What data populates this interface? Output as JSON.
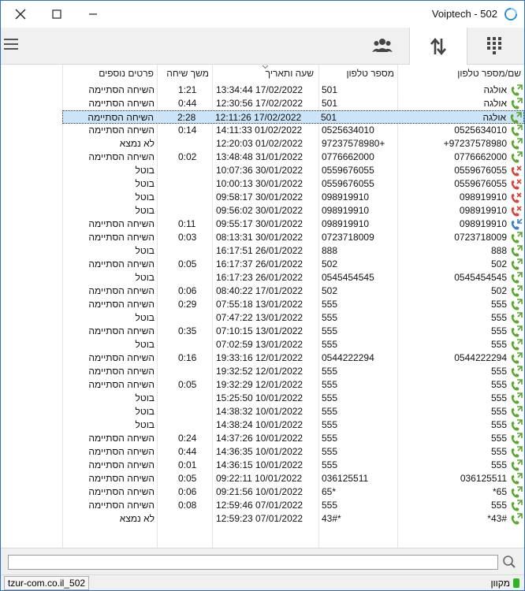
{
  "window": {
    "title": "Voiptech - 502",
    "brand_color": "#2b73c7"
  },
  "tabs": [
    {
      "name": "contacts",
      "icon": "contacts-icon"
    },
    {
      "name": "calls",
      "icon": "arrows-updown-icon",
      "active": true
    },
    {
      "name": "dialpad",
      "icon": "dialpad-icon"
    }
  ],
  "table": {
    "headers": {
      "name": "שם/מספר טלפון",
      "phone": "מספר טלפון",
      "datetime": "שעה ותאריך",
      "duration": "משך שיחה",
      "details": "פרטים נוספים"
    },
    "rows": [
      {
        "type": "out",
        "name": "אולגה",
        "phone": "501",
        "datetime": "13:34:44 17/02/2022",
        "duration": "1:21",
        "details": "השיחה הסתיימה"
      },
      {
        "type": "out",
        "name": "אולגה",
        "phone": "501",
        "datetime": "12:30:56 17/02/2022",
        "duration": "0:44",
        "details": "השיחה הסתיימה"
      },
      {
        "type": "out",
        "name": "אולגה",
        "phone": "501",
        "datetime": "12:11:26 17/02/2022",
        "duration": "2:28",
        "details": "השיחה הסתיימה",
        "selected": true
      },
      {
        "type": "out",
        "name": "0525634010",
        "phone": "0525634010",
        "datetime": "14:11:33 01/02/2022",
        "duration": "0:14",
        "details": "השיחה הסתיימה"
      },
      {
        "type": "out",
        "name": "97237578980+",
        "phone": "97237578980+",
        "datetime": "12:20:03 01/02/2022",
        "duration": "",
        "details": "לא נמצא"
      },
      {
        "type": "out",
        "name": "0776662000",
        "phone": "0776662000",
        "datetime": "13:48:48 31/01/2022",
        "duration": "0:02",
        "details": "השיחה הסתיימה"
      },
      {
        "type": "missed",
        "name": "0559676055",
        "phone": "0559676055",
        "datetime": "10:07:36 30/01/2022",
        "duration": "",
        "details": "בוטל"
      },
      {
        "type": "missed",
        "name": "0559676055",
        "phone": "0559676055",
        "datetime": "10:00:13 30/01/2022",
        "duration": "",
        "details": "בוטל"
      },
      {
        "type": "missed",
        "name": "098919910",
        "phone": "098919910",
        "datetime": "09:58:17 30/01/2022",
        "duration": "",
        "details": "בוטל"
      },
      {
        "type": "missed",
        "name": "098919910",
        "phone": "098919910",
        "datetime": "09:56:02 30/01/2022",
        "duration": "",
        "details": "בוטל"
      },
      {
        "type": "in",
        "name": "098919910",
        "phone": "098919910",
        "datetime": "09:55:17 30/01/2022",
        "duration": "0:11",
        "details": "השיחה הסתיימה"
      },
      {
        "type": "out",
        "name": "0723718009",
        "phone": "0723718009",
        "datetime": "08:13:31 30/01/2022",
        "duration": "0:03",
        "details": "השיחה הסתיימה"
      },
      {
        "type": "out",
        "name": "888",
        "phone": "888",
        "datetime": "16:17:51 26/01/2022",
        "duration": "",
        "details": "בוטל"
      },
      {
        "type": "out",
        "name": "502",
        "phone": "502",
        "datetime": "16:17:37 26/01/2022",
        "duration": "0:05",
        "details": "השיחה הסתיימה"
      },
      {
        "type": "out",
        "name": "0545454545",
        "phone": "0545454545",
        "datetime": "16:17:23 26/01/2022",
        "duration": "",
        "details": "בוטל"
      },
      {
        "type": "out",
        "name": "502",
        "phone": "502",
        "datetime": "08:40:22 17/01/2022",
        "duration": "0:06",
        "details": "השיחה הסתיימה"
      },
      {
        "type": "out",
        "name": "555",
        "phone": "555",
        "datetime": "07:55:18 13/01/2022",
        "duration": "0:29",
        "details": "השיחה הסתיימה"
      },
      {
        "type": "out",
        "name": "555",
        "phone": "555",
        "datetime": "07:47:22 13/01/2022",
        "duration": "",
        "details": "בוטל"
      },
      {
        "type": "out",
        "name": "555",
        "phone": "555",
        "datetime": "07:10:15 13/01/2022",
        "duration": "0:35",
        "details": "השיחה הסתיימה"
      },
      {
        "type": "out",
        "name": "555",
        "phone": "555",
        "datetime": "07:02:59 13/01/2022",
        "duration": "",
        "details": "בוטל"
      },
      {
        "type": "out",
        "name": "0544222294",
        "phone": "0544222294",
        "datetime": "19:33:16 12/01/2022",
        "duration": "0:16",
        "details": "השיחה הסתיימה"
      },
      {
        "type": "out",
        "name": "555",
        "phone": "555",
        "datetime": "19:32:52 12/01/2022",
        "duration": "",
        "details": "השיחה הסתיימה"
      },
      {
        "type": "out",
        "name": "555",
        "phone": "555",
        "datetime": "19:32:29 12/01/2022",
        "duration": "0:05",
        "details": "השיחה הסתיימה"
      },
      {
        "type": "out",
        "name": "555",
        "phone": "555",
        "datetime": "15:25:50 10/01/2022",
        "duration": "",
        "details": "בוטל"
      },
      {
        "type": "out",
        "name": "555",
        "phone": "555",
        "datetime": "14:38:32 10/01/2022",
        "duration": "",
        "details": "בוטל"
      },
      {
        "type": "out",
        "name": "555",
        "phone": "555",
        "datetime": "14:38:24 10/01/2022",
        "duration": "",
        "details": "בוטל"
      },
      {
        "type": "out",
        "name": "555",
        "phone": "555",
        "datetime": "14:37:26 10/01/2022",
        "duration": "0:24",
        "details": "השיחה הסתיימה"
      },
      {
        "type": "out",
        "name": "555",
        "phone": "555",
        "datetime": "14:36:35 10/01/2022",
        "duration": "0:44",
        "details": "השיחה הסתיימה"
      },
      {
        "type": "out",
        "name": "555",
        "phone": "555",
        "datetime": "14:36:15 10/01/2022",
        "duration": "0:01",
        "details": "השיחה הסתיימה"
      },
      {
        "type": "out",
        "name": "036125511",
        "phone": "036125511",
        "datetime": "09:22:11 10/01/2022",
        "duration": "0:05",
        "details": "השיחה הסתיימה"
      },
      {
        "type": "out",
        "name": "65*",
        "phone": "65*",
        "datetime": "09:21:56 10/01/2022",
        "duration": "0:06",
        "details": "השיחה הסתיימה"
      },
      {
        "type": "out",
        "name": "555",
        "phone": "555",
        "datetime": "12:59:46 07/01/2022",
        "duration": "0:08",
        "details": "השיחה הסתיימה"
      },
      {
        "type": "out",
        "name": "43#*",
        "phone": "43#*",
        "datetime": "12:59:23 07/01/2022",
        "duration": "",
        "details": "לא נמצא"
      }
    ]
  },
  "call_colors": {
    "out": "#5aa82a",
    "missed": "#d9443a",
    "in": "#3b7fd0"
  },
  "search": {
    "placeholder": ""
  },
  "status": {
    "account": "tzur-com.co.il_502",
    "presence": "מקוון",
    "presence_color": "#2fb31f"
  }
}
